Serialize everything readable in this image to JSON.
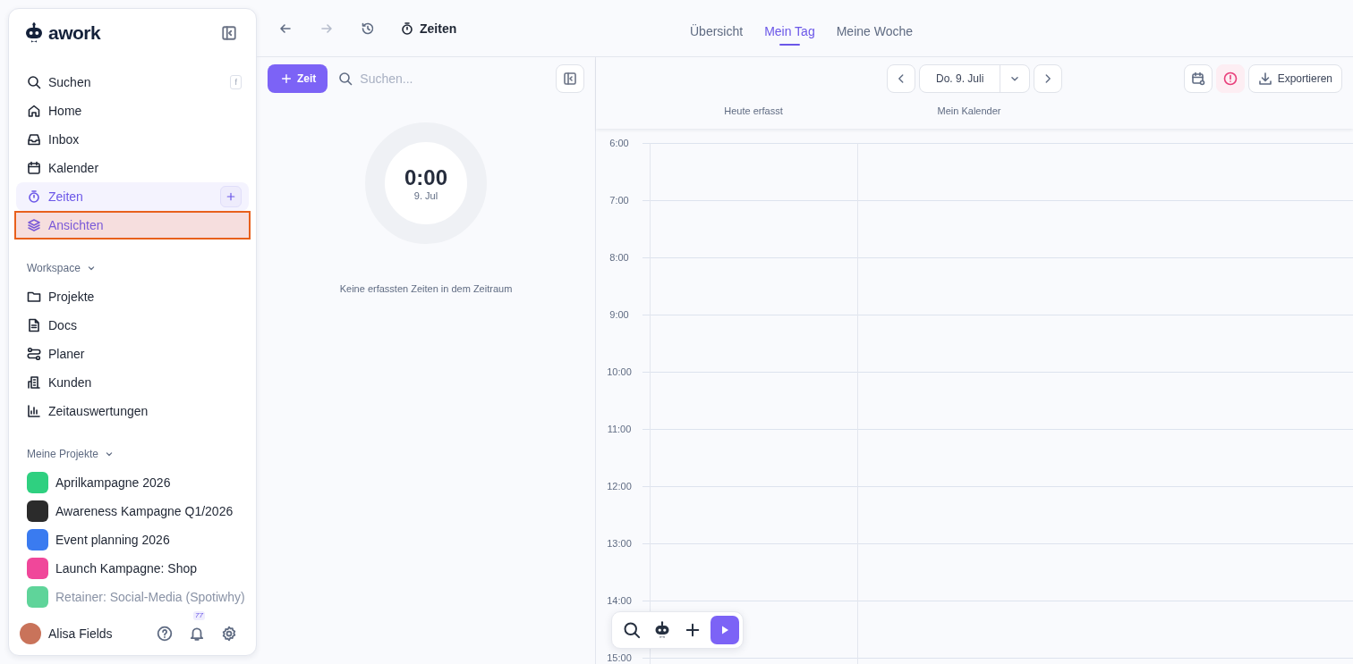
{
  "sidebar": {
    "logo": "awork",
    "nav": [
      {
        "label": "Suchen",
        "shortcut": "f",
        "selected": false,
        "highlighted": false
      },
      {
        "label": "Home",
        "selected": false,
        "highlighted": false
      },
      {
        "label": "Inbox",
        "selected": false,
        "highlighted": false
      },
      {
        "label": "Kalender",
        "selected": false,
        "highlighted": false
      },
      {
        "label": "Zeiten",
        "selected": true,
        "highlighted": false
      },
      {
        "label": "Ansichten",
        "selected": false,
        "highlighted": true
      }
    ],
    "workspace": {
      "title": "Workspace",
      "expanded": true,
      "items": [
        "Projekte",
        "Docs",
        "Planer",
        "Kunden",
        "Zeitauswertungen"
      ]
    },
    "my_projects": {
      "title": "Meine Projekte",
      "expanded": true,
      "items": [
        {
          "name": "Aprilkampagne 2026",
          "color": "#2fd080",
          "faded": false
        },
        {
          "name": "Awareness Kampagne Q1/2026",
          "color": "#2b2b2b",
          "faded": false
        },
        {
          "name": "Event planning 2026",
          "color": "#3a7bf0",
          "faded": false
        },
        {
          "name": "Launch Kampagne: Shop",
          "color": "#f0479a",
          "faded": false
        },
        {
          "name": "Retainer: Social-Media (Spotiwhy)",
          "color": "#5fd49a",
          "faded": true
        }
      ]
    },
    "user": {
      "name": "Alisa Fields",
      "notifications": "77"
    }
  },
  "topbar": {
    "title": "Zeiten",
    "tabs": [
      {
        "label": "Übersicht",
        "selected": false
      },
      {
        "label": "Mein Tag",
        "selected": true
      },
      {
        "label": "Meine Woche",
        "selected": false
      }
    ]
  },
  "time_panel": {
    "add_button": "Zeit",
    "search": {
      "placeholder": "Suchen..."
    },
    "total": "0:00",
    "date": "9. Jul",
    "empty_message": "Keine erfassten Zeiten in dem Zeitraum"
  },
  "calendar": {
    "date": "Do. 9. Juli",
    "export_button": "Exportieren",
    "columns": [
      "Heute erfasst",
      "Mein Kalender"
    ],
    "hours": [
      "6:00",
      "7:00",
      "8:00",
      "9:00",
      "10:00",
      "11:00",
      "12:00",
      "13:00",
      "14:00",
      "15:00"
    ]
  }
}
